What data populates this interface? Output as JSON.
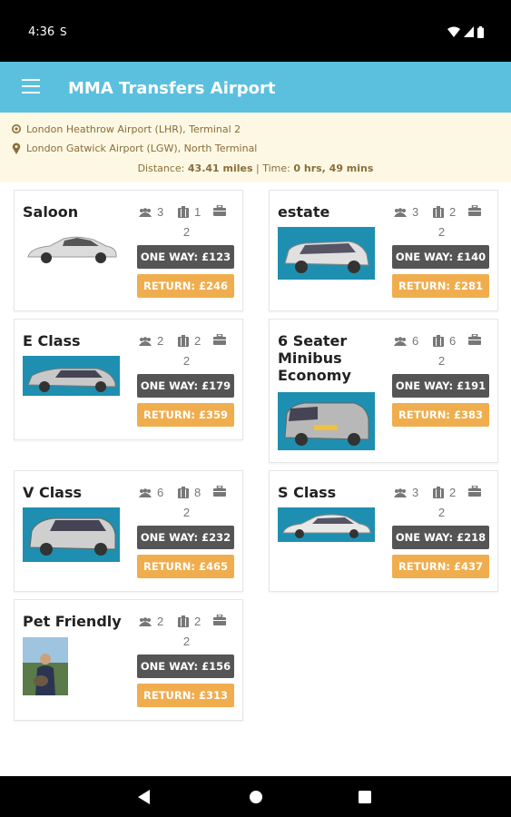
{
  "status_bar": {
    "time": "4:36",
    "dnd_glyph": "S"
  },
  "app_bar": {
    "title": "MMA Transfers Airport"
  },
  "route": {
    "from": "London Heathrow Airport (LHR), Terminal 2",
    "to": "London Gatwick Airport (LGW), North Terminal",
    "distance_label": "Distance:",
    "distance_value": "43.41 miles",
    "separator": " | ",
    "time_label": "Time:",
    "time_value": "0 hrs, 49 mins"
  },
  "vehicles": [
    {
      "name": "Saloon",
      "passengers": "3",
      "luggage": "1",
      "hand_luggage": "2",
      "one_way": "ONE WAY: £123",
      "return": "RETURN: £246"
    },
    {
      "name": "estate",
      "passengers": "3",
      "luggage": "2",
      "hand_luggage": "2",
      "one_way": "ONE WAY: £140",
      "return": "RETURN: £281"
    },
    {
      "name": "E Class",
      "passengers": "2",
      "luggage": "2",
      "hand_luggage": "2",
      "one_way": "ONE WAY: £179",
      "return": "RETURN: £359"
    },
    {
      "name": "6 Seater Minibus Economy",
      "passengers": "6",
      "luggage": "6",
      "hand_luggage": "2",
      "one_way": "ONE WAY: £191",
      "return": "RETURN: £383"
    },
    {
      "name": "V Class",
      "passengers": "6",
      "luggage": "8",
      "hand_luggage": "2",
      "one_way": "ONE WAY: £232",
      "return": "RETURN: £465"
    },
    {
      "name": "S Class",
      "passengers": "3",
      "luggage": "2",
      "hand_luggage": "2",
      "one_way": "ONE WAY: £218",
      "return": "RETURN: £437"
    },
    {
      "name": "Pet Friendly",
      "passengers": "2",
      "luggage": "2",
      "hand_luggage": "2",
      "one_way": "ONE WAY: £156",
      "return": "RETURN: £313"
    }
  ],
  "icons": {
    "passengers": "users-icon",
    "luggage": "suitcase-icon",
    "hand_luggage": "briefcase-icon",
    "location": "map-marker-icon"
  },
  "colors": {
    "app_bar": "#5bc0de",
    "route_bg": "#fcf8e3",
    "route_text": "#8a6d3b",
    "one_way_btn": "#555555",
    "return_btn": "#f0ad4e"
  }
}
